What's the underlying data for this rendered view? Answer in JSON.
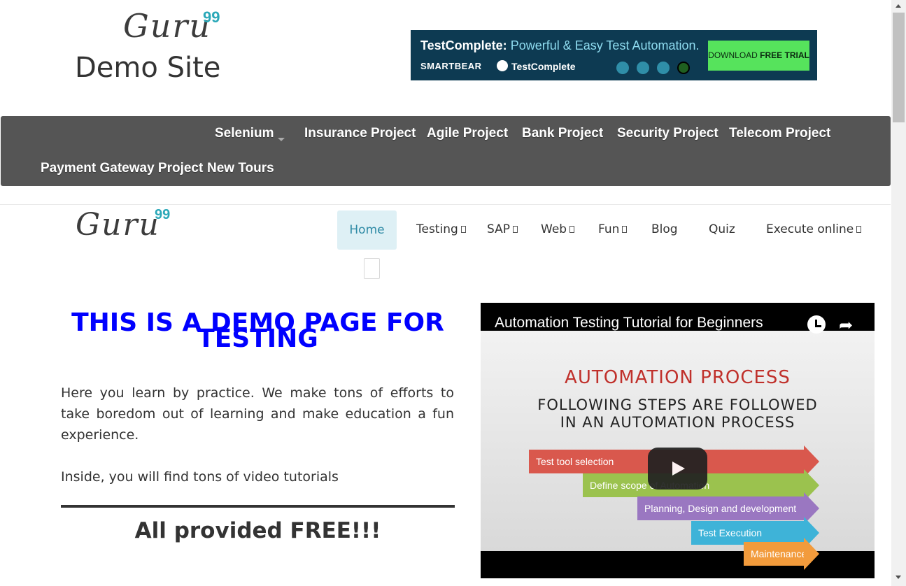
{
  "header": {
    "logo_text": "Guru",
    "logo_sup": "99",
    "site_title": "Demo Site"
  },
  "ad": {
    "headline_brand": "TestComplete:",
    "headline_tagline": "Powerful & Easy Test Automation.",
    "company": "SMARTBEAR",
    "product": "TestComplete",
    "cta_prefix": "DOWNLOAD",
    "cta_bold": "FREE TRIAL"
  },
  "top_nav": {
    "items": [
      "Selenium",
      "Insurance Project",
      "Agile Project",
      "Bank Project",
      "Security Project",
      "Telecom Project",
      "Payment Gateway Project",
      "New Tours"
    ]
  },
  "main_nav": {
    "logo_text": "Guru",
    "logo_sup": "99",
    "items": [
      "Home",
      "Testing",
      "SAP",
      "Web",
      "Fun",
      "Blog",
      "Quiz",
      "Execute online"
    ],
    "active": "Home"
  },
  "content": {
    "heading": "THIS IS A DEMO PAGE FOR TESTING",
    "intro": "Here you learn by practice. We make tons of efforts to take boredom out of learning and make education a fun experience.",
    "intro2": "Inside, you will find tons of video tutorials",
    "free_text": "All provided FREE!!!"
  },
  "video": {
    "title": "Automation Testing Tutorial for Beginners",
    "slide_heading": "AUTOMATION PROCESS",
    "slide_subheading_1": "FOLLOWING STEPS ARE FOLLOWED",
    "slide_subheading_2": "IN AN AUTOMATION PROCESS",
    "steps": [
      "Test tool selection",
      "Define scope of Automation",
      "Planning, Design and development",
      "Test Execution",
      "Maintenance"
    ]
  },
  "colors": {
    "nav_bg": "#555555",
    "heading_blue": "#0000ff",
    "active_tab_bg": "#def0f5",
    "logo_accent": "#2aa8b8"
  }
}
